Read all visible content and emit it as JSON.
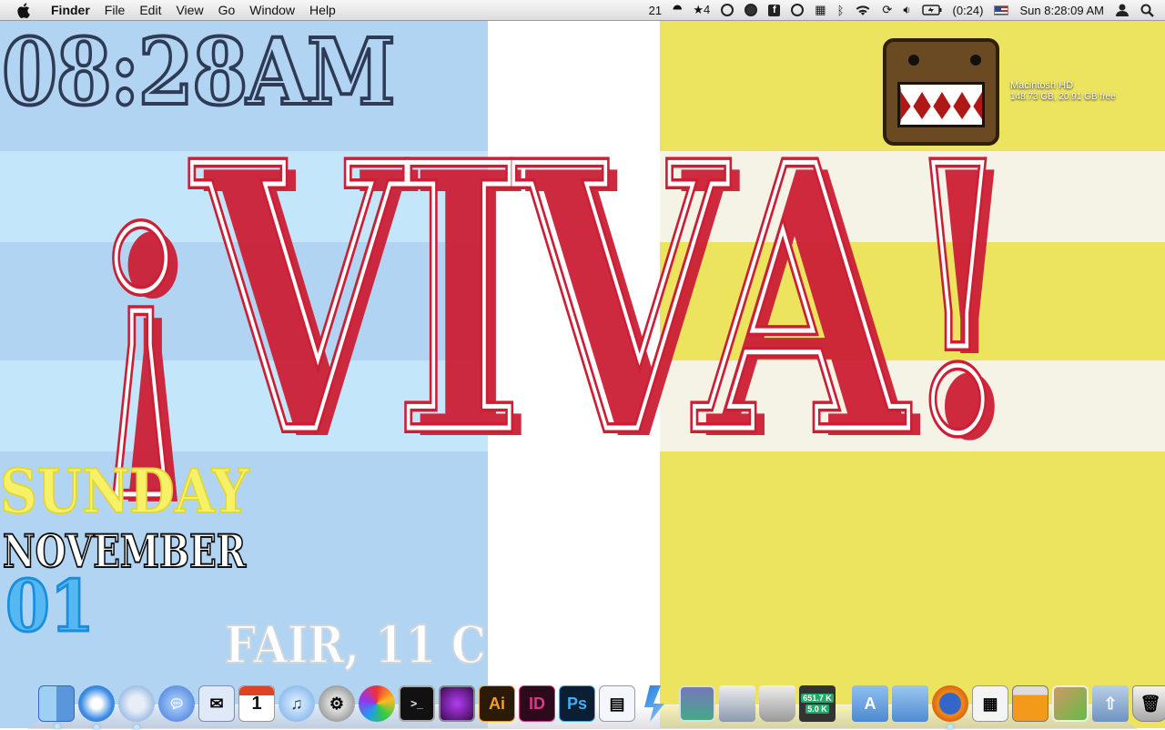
{
  "menubar": {
    "app_name": "Finder",
    "menus": [
      "File",
      "Edit",
      "View",
      "Go",
      "Window",
      "Help"
    ],
    "extras": {
      "spaces": "21",
      "star_count": "★4",
      "battery": "(0:24)",
      "clock": "Sun 8:28:09 AM"
    }
  },
  "widget": {
    "time": "08:28AM",
    "banner": "¡VIVA!",
    "day": "SUNDAY",
    "month": "NOVEMBER",
    "date": "01",
    "weather": "FAIR, 11 C",
    "colors": {
      "time_fill": "#b2d4f3",
      "time_outline": "#2f3b55",
      "banner": "#cc1f35",
      "day": "#f7f168",
      "date": "#56b8f2"
    }
  },
  "desktop": {
    "disk_name": "Macintosh HD",
    "disk_info": "148.73 GB, 20.91 GB free"
  },
  "dock": {
    "items": [
      {
        "name": "finder-icon",
        "label": ""
      },
      {
        "name": "safari-icon",
        "label": ""
      },
      {
        "name": "compass-icon",
        "label": ""
      },
      {
        "name": "ichat-icon",
        "label": ""
      },
      {
        "name": "mail-icon",
        "label": ""
      },
      {
        "name": "ical-icon",
        "label": "1"
      },
      {
        "name": "itunes-icon",
        "label": "♫"
      },
      {
        "name": "system-preferences-icon",
        "label": ""
      },
      {
        "name": "color-wheel-icon",
        "label": ""
      },
      {
        "name": "terminal-icon",
        "label": ">_"
      },
      {
        "name": "purple-app-icon",
        "label": ""
      },
      {
        "name": "illustrator-icon",
        "label": "Ai"
      },
      {
        "name": "indesign-icon",
        "label": "ID"
      },
      {
        "name": "photoshop-icon",
        "label": "Ps"
      },
      {
        "name": "document-icon",
        "label": ""
      },
      {
        "name": "bolt-icon",
        "label": ""
      },
      {
        "name": "photo-icon",
        "label": ""
      },
      {
        "name": "scanner-icon",
        "label": ""
      },
      {
        "name": "utility-icon",
        "label": ""
      }
    ],
    "network_up": "651.7 K",
    "network_down": "5.0 K",
    "right_items": [
      {
        "name": "applications-folder-icon",
        "label": "A"
      },
      {
        "name": "documents-folder-icon",
        "label": ""
      },
      {
        "name": "firefox-icon",
        "label": ""
      },
      {
        "name": "spreadsheet-icon",
        "label": ""
      },
      {
        "name": "browser-window-icon",
        "label": ""
      },
      {
        "name": "pictures-icon",
        "label": ""
      },
      {
        "name": "shared-folder-icon",
        "label": ""
      },
      {
        "name": "trash-icon",
        "label": ""
      }
    ]
  }
}
